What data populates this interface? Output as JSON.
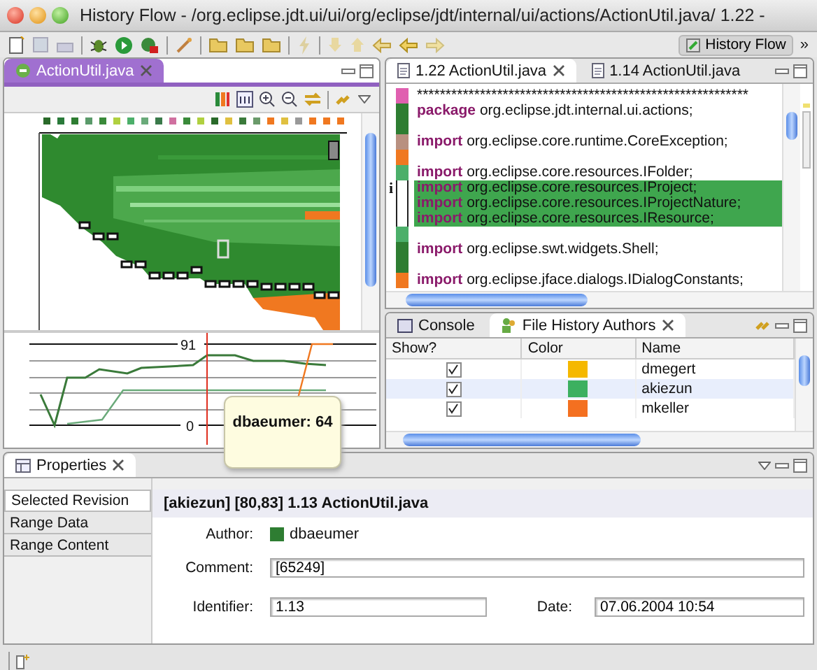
{
  "window": {
    "title": "History Flow - /org.eclipse.jdt.ui/ui/org/eclipse/jdt/internal/ui/actions/ActionUtil.java/ 1.22 -"
  },
  "toolbar": {
    "perspective_button": "History Flow",
    "overflow": "»"
  },
  "flow_view": {
    "tab": "ActionUtil.java",
    "chart_top_label": "91",
    "chart_bottom_label": "0",
    "tooltip": "dbaeumer: 64"
  },
  "editor": {
    "tabs": [
      {
        "title": "1.22 ActionUtil.java",
        "selected": true
      },
      {
        "title": "1.14 ActionUtil.java",
        "selected": false
      }
    ],
    "lines": [
      {
        "text": "**********************************************************",
        "color": "#e060b0",
        "highlighted": false
      },
      {
        "keyword": "package",
        "text": " org.eclipse.jdt.internal.ui.actions;",
        "color": "#2e7d32",
        "highlighted": false
      },
      {
        "color": "#2e7d32",
        "highlighted": false
      },
      {
        "keyword": "import",
        "text": " org.eclipse.core.runtime.CoreException;",
        "color": "#b89080",
        "highlighted": false
      },
      {
        "color": "#f07820",
        "highlighted": false
      },
      {
        "keyword": "import",
        "text": " org.eclipse.core.resources.IFolder;",
        "color": "#4caf6a",
        "highlighted": false
      },
      {
        "keyword": "import",
        "text": " org.eclipse.core.resources.IProject;",
        "highlighted": true,
        "annotation": "i"
      },
      {
        "keyword": "import",
        "text": " org.eclipse.core.resources.IProjectNature;",
        "highlighted": true
      },
      {
        "keyword": "import",
        "text": " org.eclipse.core.resources.IResource;",
        "highlighted": true
      },
      {
        "color": "#4caf6a",
        "highlighted": false
      },
      {
        "keyword": "import",
        "text": " org.eclipse.swt.widgets.Shell;",
        "color": "#2e7d32",
        "highlighted": false
      },
      {
        "color": "#2e7d32",
        "highlighted": false
      },
      {
        "keyword": "import",
        "text": " org.eclipse.jface.dialogs.IDialogConstants;",
        "color": "#f07820",
        "highlighted": false
      }
    ]
  },
  "authors_view": {
    "tabs": [
      {
        "title": "Console",
        "selected": false
      },
      {
        "title": "File History Authors",
        "selected": true
      }
    ],
    "columns": [
      "Show?",
      "Color",
      "Name"
    ],
    "rows": [
      {
        "show": true,
        "color": "#f5b800",
        "name": "dmegert",
        "selected": false
      },
      {
        "show": true,
        "color": "#3cb060",
        "name": "akiezun",
        "selected": true
      },
      {
        "show": true,
        "color": "#f47020",
        "name": "mkeller",
        "selected": false
      }
    ]
  },
  "properties": {
    "title": "Properties",
    "tabs": [
      {
        "label": "Selected Revision",
        "selected": true
      },
      {
        "label": "Range Data",
        "selected": false
      },
      {
        "label": "Range Content",
        "selected": false
      }
    ],
    "heading": "[akiezun] [80,83] 1.13 ActionUtil.java",
    "author": {
      "label": "Author:",
      "value": "dbaeumer",
      "color": "#2e7d32"
    },
    "comment": {
      "label": "Comment:",
      "value": "[65249]"
    },
    "identifier": {
      "label": "Identifier:",
      "value": "1.13"
    },
    "date": {
      "label": "Date:",
      "value": "07.06.2004 10:54"
    }
  }
}
